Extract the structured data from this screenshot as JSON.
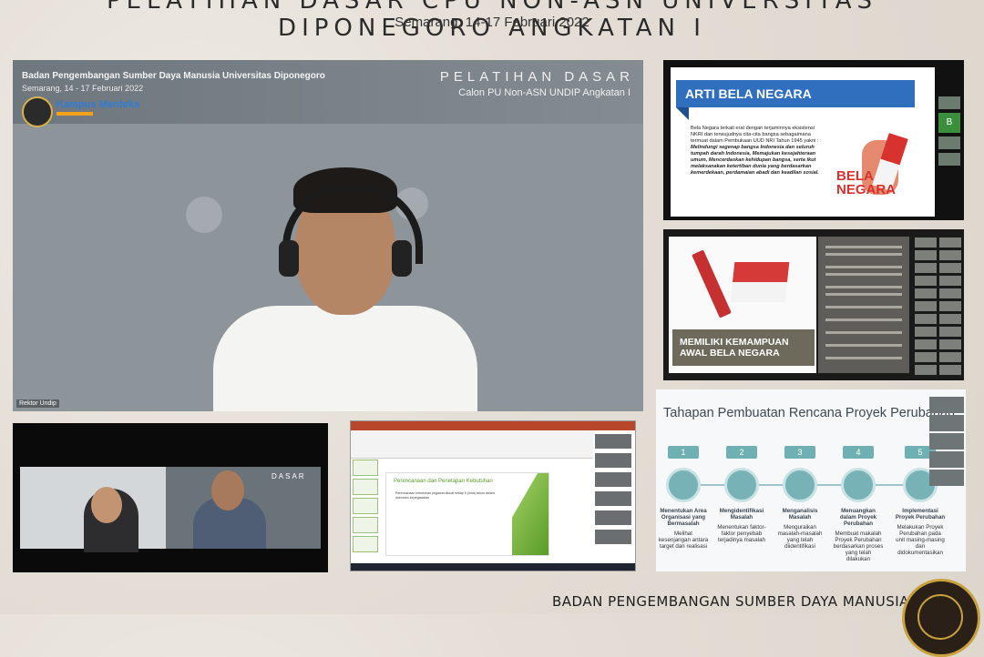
{
  "header": {
    "title": "PELATIHAN DASAR CPU NON-ASN UNIVERSITAS DIPONEGORO ANGKATAN I",
    "subtitle": "Semarang, 14-17 Februari 2022"
  },
  "footer": {
    "org": "BADAN PENGEMBANGAN SUMBER DAYA MANUSIA"
  },
  "main_video": {
    "org_line": "Badan Pengembangan Sumber Daya Manusia Universitas Diponegoro",
    "date_line": "Semarang, 14 - 17 Februari 2022",
    "title": "PELATIHAN DASAR",
    "subtitle": "Calon PU Non-ASN UNDIP Angkatan I",
    "logo_text": "Kampus Merdeka",
    "participant_name": "Rektor Undip"
  },
  "slide_bela_negara": {
    "title": "ARTI BELA NEGARA",
    "text": "Bela Negara terkait erat dengan terjaminnya eksistensi NKRI dan terwujudnya cita-cita bangsa sebagaimana termuat dalam Pembukaan UUD NRI Tahun 1945 yakni :",
    "quote": "Melindungi segenap bangsa Indonesia dan seluruh tumpah darah Indonesia, Memajukan kesejahteraan umum, Mencerdaskan kehidupan bangsa, serta ikut melaksanakan ketertiban dunia yang berdasarkan kemerdekaan, perdamaian abadi dan keadilan sosial.",
    "logo_line1": "BELA",
    "logo_line2": "NEGARA",
    "side_tile": "B"
  },
  "slide_kemampuan": {
    "title": "MEMILIKI KEMAMPUAN AWAL BELA NEGARA"
  },
  "slide_tahapan": {
    "title": "Tahapan Pembuatan Rencana Proyek Perubahan",
    "steps": [
      {
        "num": "1",
        "head": "Menentukan Area Organisasi yang Bermasalah",
        "desc": "Melihat kesenjangan antara target dan realisasi"
      },
      {
        "num": "2",
        "head": "Mengidentifikasi Masalah",
        "desc": "Menentukan faktor-faktor penyebab terjadinya masalah"
      },
      {
        "num": "3",
        "head": "Menganalisis Masalah",
        "desc": "Menguraikan masalah-masalah yang telah diidentifikasi"
      },
      {
        "num": "4",
        "head": "Menuangkan dalam Proyek Perubahan",
        "desc": "Membuat makalah Proyek Perubahan berdasarkan proses yang telah dilakukan"
      },
      {
        "num": "5",
        "head": "Implementasi Proyek Perubahan",
        "desc": "Melakukan Proyek Perubahan pada unit masing-masing dan didokumentasikan"
      }
    ]
  },
  "small_video": {
    "title": "DASAR"
  },
  "ppt_window": {
    "slide_title": "Perencanaan dan Penetapan Kebutuhan",
    "slide_text": "Perencanaan kebutuhan pegawai dibuat setiap 5 (lima) tahun dalam dokumen kepegawaian.",
    "colors": {
      "accent": "#b7472a",
      "green": "#5a9b28"
    }
  }
}
